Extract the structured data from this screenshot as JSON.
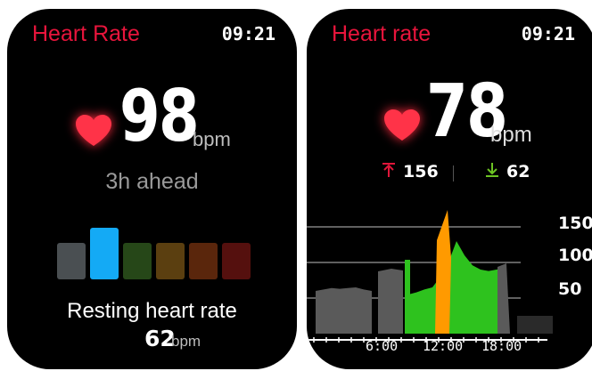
{
  "watch1": {
    "title": "Heart Rate",
    "time": "09:21",
    "heart_rate_value": "98",
    "heart_rate_unit": "bpm",
    "ahead_text": "3h ahead",
    "zones": [
      {
        "color": "#4a4f52",
        "level": 0.7,
        "active": false
      },
      {
        "color": "#14aaf5",
        "level": 1.0,
        "active": true
      },
      {
        "color": "#264718",
        "level": 0.7,
        "active": false
      },
      {
        "color": "#5b3f10",
        "level": 0.7,
        "active": false
      },
      {
        "color": "#5a260c",
        "level": 0.7,
        "active": false
      },
      {
        "color": "#55100e",
        "level": 0.7,
        "active": false
      }
    ],
    "resting_label": "Resting heart rate",
    "resting_value": "62",
    "resting_unit": "bpm"
  },
  "watch2": {
    "title": "Heart rate",
    "time": "09:21",
    "heart_rate_value": "78",
    "heart_rate_unit": "bpm",
    "max_value": "156",
    "min_value": "62",
    "icons": {
      "max": "arrow-up-icon",
      "min": "arrow-down-icon",
      "heart": "heart-icon"
    }
  },
  "chart_data": {
    "type": "area",
    "x": [
      0,
      1,
      2,
      3,
      4,
      5,
      6,
      7,
      8,
      9,
      10,
      11,
      12,
      13,
      14,
      15,
      16,
      17,
      18,
      19,
      20,
      21,
      22,
      23,
      24
    ],
    "x_ticks": [
      "6:00",
      "12:00",
      "18:00"
    ],
    "y_ticks": [
      150,
      100,
      50
    ],
    "ylim": [
      0,
      200
    ],
    "series": [
      {
        "values": [
          60,
          62,
          64,
          63,
          64,
          65,
          62,
          60
        ]
      },
      {
        "values": [
          55,
          58,
          62,
          65,
          80,
          100,
          130,
          110,
          96,
          90,
          88,
          90,
          92
        ]
      }
    ],
    "colors": {
      "rest": "#5a5a5a",
      "active": "#2ec21e",
      "peak": "#ff9a00",
      "line": "#ffffff"
    },
    "grid": true
  }
}
